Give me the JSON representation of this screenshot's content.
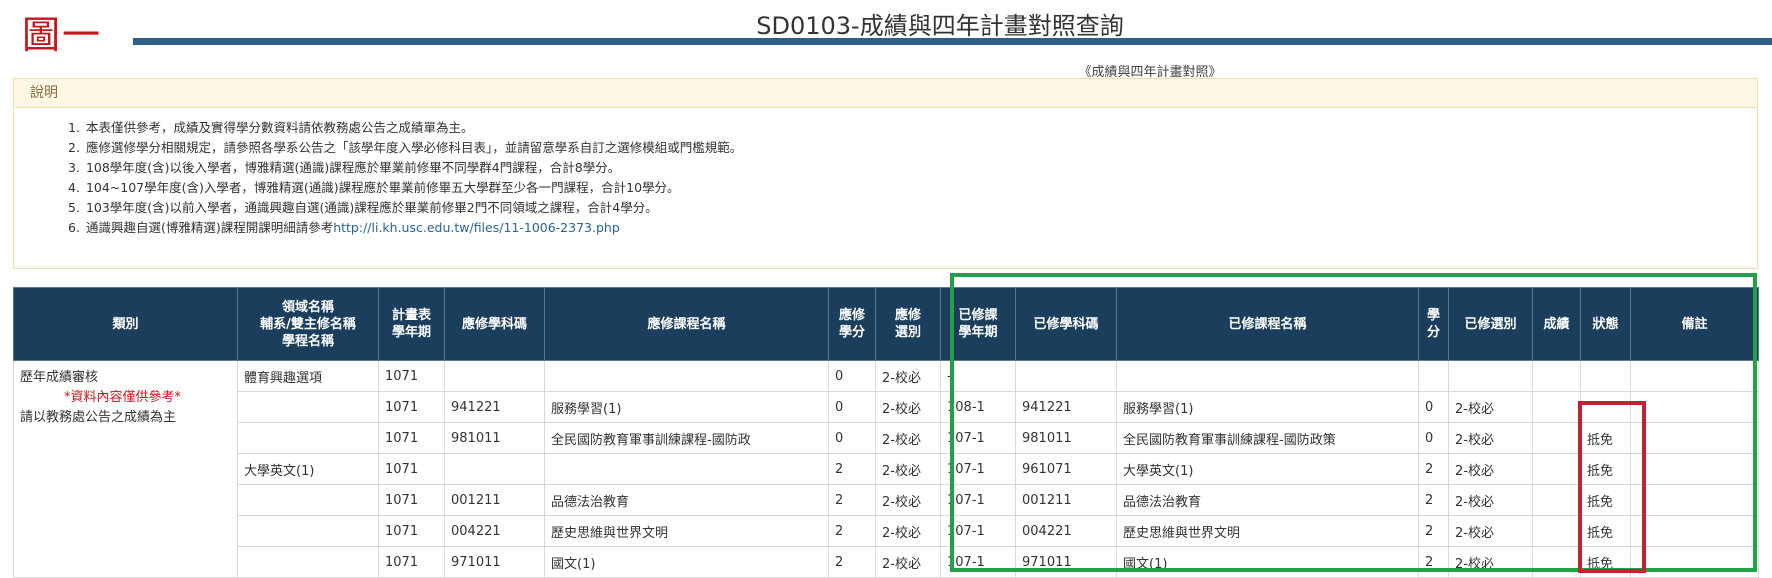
{
  "figure_label": "圖一",
  "page_title": "SD0103-成績與四年計畫對照查詢",
  "subtitle": "《成績與四年計畫對照》",
  "notes": {
    "title": "說明",
    "items": [
      {
        "num": "1.",
        "text": "本表僅供參考，成績及實得學分數資料請依教務處公告之成績單為主。"
      },
      {
        "num": "2.",
        "text": "應修選修學分相關規定，請參照各學系公告之「該學年度入學必修科目表」，並請留意學系自訂之選修模組或門檻規範。"
      },
      {
        "num": "3.",
        "text": "108學年度(含)以後入學者，博雅精選(通識)課程應於畢業前修畢不同學群4門課程，合計8學分。"
      },
      {
        "num": "4.",
        "text": "104~107學年度(含)入學者，博雅精選(通識)課程應於畢業前修畢五大學群至少各一門課程，合計10學分。"
      },
      {
        "num": "5.",
        "text": "103學年度(含)以前入學者，通識興趣自選(通識)課程應於畢業前修畢2門不同領域之課程，合計4學分。"
      },
      {
        "num": "6.",
        "text": "通識興趣自選(博雅精選)課程開課明細請參考",
        "link": "http://li.kh.usc.edu.tw/files/11-1006-2373.php"
      }
    ]
  },
  "table": {
    "headers": [
      {
        "lines": [
          "類別"
        ]
      },
      {
        "lines": [
          "領域名稱",
          "輔系/雙主修名稱",
          "學程名稱"
        ]
      },
      {
        "lines": [
          "計畫表",
          "學年期"
        ]
      },
      {
        "lines": [
          "應修學科碼"
        ]
      },
      {
        "lines": [
          "應修課程名稱"
        ]
      },
      {
        "lines": [
          "應修",
          "學分"
        ]
      },
      {
        "lines": [
          "應修",
          "選別"
        ]
      },
      {
        "lines": [
          "已修課",
          "學年期"
        ]
      },
      {
        "lines": [
          "已修學科碼"
        ]
      },
      {
        "lines": [
          "已修課程名稱"
        ]
      },
      {
        "lines": [
          "學",
          "分"
        ]
      },
      {
        "lines": [
          "已修選別"
        ]
      },
      {
        "lines": [
          "成績"
        ]
      },
      {
        "lines": [
          "狀態"
        ]
      },
      {
        "lines": [
          "備註"
        ]
      }
    ],
    "category": {
      "line1": "歷年成績審核",
      "line2": "*資料內容僅供參考*",
      "line3": "請以教務處公告之成績為主"
    },
    "rows": [
      [
        "體育興趣選項",
        "1071",
        "",
        "",
        "0",
        "2-校必",
        "-",
        "",
        "",
        "",
        "",
        "",
        "",
        ""
      ],
      [
        "",
        "1071",
        "941221",
        "服務學習(1)",
        "0",
        "2-校必",
        "108-1",
        "941221",
        "服務學習(1)",
        "0",
        "2-校必",
        "",
        "",
        ""
      ],
      [
        "",
        "1071",
        "981011",
        "全民國防教育軍事訓練課程-國防政",
        "0",
        "2-校必",
        "107-1",
        "981011",
        "全民國防教育軍事訓練課程-國防政策",
        "0",
        "2-校必",
        "",
        "抵免",
        ""
      ],
      [
        "大學英文(1)",
        "1071",
        "",
        "",
        "2",
        "2-校必",
        "107-1",
        "961071",
        "大學英文(1)",
        "2",
        "2-校必",
        "",
        "抵免",
        ""
      ],
      [
        "",
        "1071",
        "001211",
        "品德法治教育",
        "2",
        "2-校必",
        "107-1",
        "001211",
        "品德法治教育",
        "2",
        "2-校必",
        "",
        "抵免",
        ""
      ],
      [
        "",
        "1071",
        "004221",
        "歷史思維與世界文明",
        "2",
        "2-校必",
        "107-1",
        "004221",
        "歷史思維與世界文明",
        "2",
        "2-校必",
        "",
        "抵免",
        ""
      ],
      [
        "",
        "1071",
        "971011",
        "國文(1)",
        "2",
        "2-校必",
        "107-1",
        "971011",
        "國文(1)",
        "2",
        "2-校必",
        "",
        "抵免",
        ""
      ]
    ]
  },
  "highlight_colors": {
    "completed_box": "#23a14a",
    "status_box": "#c82030"
  }
}
